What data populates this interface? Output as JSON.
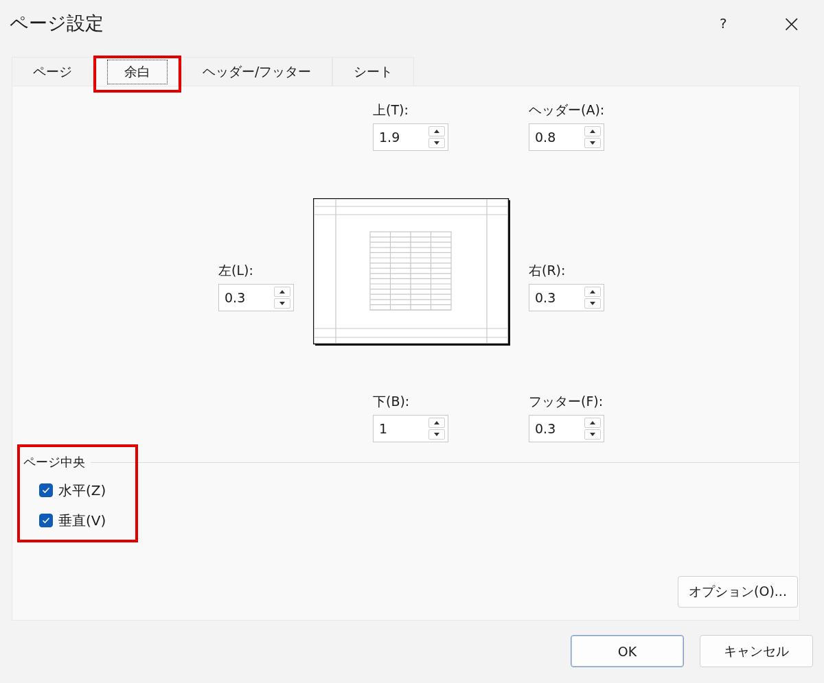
{
  "window": {
    "title": "ページ設定",
    "help": "?",
    "close": "×"
  },
  "tabs": [
    {
      "label": "ページ",
      "selected": false,
      "highlighted": false
    },
    {
      "label": "余白",
      "selected": true,
      "highlighted": true
    },
    {
      "label": "ヘッダー/フッター",
      "selected": false,
      "highlighted": false
    },
    {
      "label": "シート",
      "selected": false,
      "highlighted": false
    }
  ],
  "margins": {
    "top": {
      "label": "上(T):",
      "value": "1.9"
    },
    "header": {
      "label": "ヘッダー(A):",
      "value": "0.8"
    },
    "left": {
      "label": "左(L):",
      "value": "0.3"
    },
    "right": {
      "label": "右(R):",
      "value": "0.3"
    },
    "bottom": {
      "label": "下(B):",
      "value": "1"
    },
    "footer": {
      "label": "フッター(F):",
      "value": "0.3"
    }
  },
  "center_on_page": {
    "title": "ページ中央",
    "highlighted": true,
    "options": [
      {
        "label": "水平(Z)",
        "checked": true
      },
      {
        "label": "垂直(V)",
        "checked": true
      }
    ]
  },
  "options_button": "オプション(O)...",
  "buttons": [
    {
      "label": "OK",
      "default": true
    },
    {
      "label": "キャンセル",
      "default": false
    }
  ]
}
